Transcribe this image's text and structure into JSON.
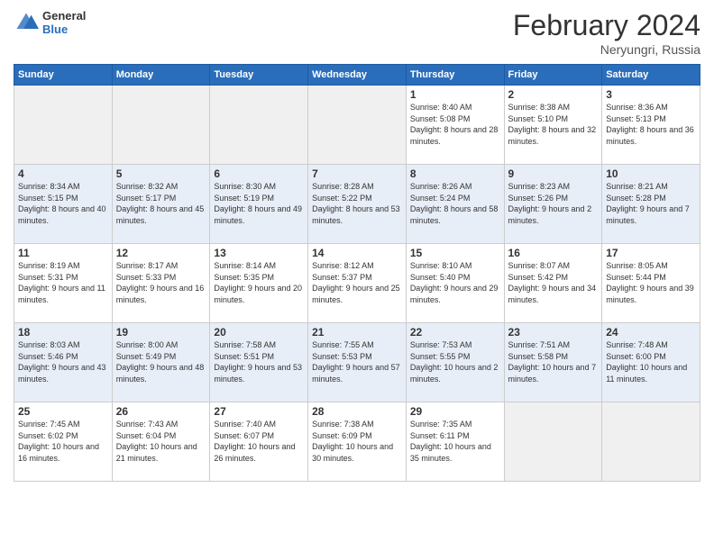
{
  "logo": {
    "general": "General",
    "blue": "Blue"
  },
  "title": {
    "month_year": "February 2024",
    "location": "Neryungri, Russia"
  },
  "headers": [
    "Sunday",
    "Monday",
    "Tuesday",
    "Wednesday",
    "Thursday",
    "Friday",
    "Saturday"
  ],
  "weeks": [
    {
      "row_class": "row-white",
      "days": [
        {
          "number": "",
          "info": "",
          "empty": true
        },
        {
          "number": "",
          "info": "",
          "empty": true
        },
        {
          "number": "",
          "info": "",
          "empty": true
        },
        {
          "number": "",
          "info": "",
          "empty": true
        },
        {
          "number": "1",
          "info": "Sunrise: 8:40 AM\nSunset: 5:08 PM\nDaylight: 8 hours\nand 28 minutes.",
          "empty": false
        },
        {
          "number": "2",
          "info": "Sunrise: 8:38 AM\nSunset: 5:10 PM\nDaylight: 8 hours\nand 32 minutes.",
          "empty": false
        },
        {
          "number": "3",
          "info": "Sunrise: 8:36 AM\nSunset: 5:13 PM\nDaylight: 8 hours\nand 36 minutes.",
          "empty": false
        }
      ]
    },
    {
      "row_class": "row-blue",
      "days": [
        {
          "number": "4",
          "info": "Sunrise: 8:34 AM\nSunset: 5:15 PM\nDaylight: 8 hours\nand 40 minutes.",
          "empty": false
        },
        {
          "number": "5",
          "info": "Sunrise: 8:32 AM\nSunset: 5:17 PM\nDaylight: 8 hours\nand 45 minutes.",
          "empty": false
        },
        {
          "number": "6",
          "info": "Sunrise: 8:30 AM\nSunset: 5:19 PM\nDaylight: 8 hours\nand 49 minutes.",
          "empty": false
        },
        {
          "number": "7",
          "info": "Sunrise: 8:28 AM\nSunset: 5:22 PM\nDaylight: 8 hours\nand 53 minutes.",
          "empty": false
        },
        {
          "number": "8",
          "info": "Sunrise: 8:26 AM\nSunset: 5:24 PM\nDaylight: 8 hours\nand 58 minutes.",
          "empty": false
        },
        {
          "number": "9",
          "info": "Sunrise: 8:23 AM\nSunset: 5:26 PM\nDaylight: 9 hours\nand 2 minutes.",
          "empty": false
        },
        {
          "number": "10",
          "info": "Sunrise: 8:21 AM\nSunset: 5:28 PM\nDaylight: 9 hours\nand 7 minutes.",
          "empty": false
        }
      ]
    },
    {
      "row_class": "row-white",
      "days": [
        {
          "number": "11",
          "info": "Sunrise: 8:19 AM\nSunset: 5:31 PM\nDaylight: 9 hours\nand 11 minutes.",
          "empty": false
        },
        {
          "number": "12",
          "info": "Sunrise: 8:17 AM\nSunset: 5:33 PM\nDaylight: 9 hours\nand 16 minutes.",
          "empty": false
        },
        {
          "number": "13",
          "info": "Sunrise: 8:14 AM\nSunset: 5:35 PM\nDaylight: 9 hours\nand 20 minutes.",
          "empty": false
        },
        {
          "number": "14",
          "info": "Sunrise: 8:12 AM\nSunset: 5:37 PM\nDaylight: 9 hours\nand 25 minutes.",
          "empty": false
        },
        {
          "number": "15",
          "info": "Sunrise: 8:10 AM\nSunset: 5:40 PM\nDaylight: 9 hours\nand 29 minutes.",
          "empty": false
        },
        {
          "number": "16",
          "info": "Sunrise: 8:07 AM\nSunset: 5:42 PM\nDaylight: 9 hours\nand 34 minutes.",
          "empty": false
        },
        {
          "number": "17",
          "info": "Sunrise: 8:05 AM\nSunset: 5:44 PM\nDaylight: 9 hours\nand 39 minutes.",
          "empty": false
        }
      ]
    },
    {
      "row_class": "row-blue",
      "days": [
        {
          "number": "18",
          "info": "Sunrise: 8:03 AM\nSunset: 5:46 PM\nDaylight: 9 hours\nand 43 minutes.",
          "empty": false
        },
        {
          "number": "19",
          "info": "Sunrise: 8:00 AM\nSunset: 5:49 PM\nDaylight: 9 hours\nand 48 minutes.",
          "empty": false
        },
        {
          "number": "20",
          "info": "Sunrise: 7:58 AM\nSunset: 5:51 PM\nDaylight: 9 hours\nand 53 minutes.",
          "empty": false
        },
        {
          "number": "21",
          "info": "Sunrise: 7:55 AM\nSunset: 5:53 PM\nDaylight: 9 hours\nand 57 minutes.",
          "empty": false
        },
        {
          "number": "22",
          "info": "Sunrise: 7:53 AM\nSunset: 5:55 PM\nDaylight: 10 hours\nand 2 minutes.",
          "empty": false
        },
        {
          "number": "23",
          "info": "Sunrise: 7:51 AM\nSunset: 5:58 PM\nDaylight: 10 hours\nand 7 minutes.",
          "empty": false
        },
        {
          "number": "24",
          "info": "Sunrise: 7:48 AM\nSunset: 6:00 PM\nDaylight: 10 hours\nand 11 minutes.",
          "empty": false
        }
      ]
    },
    {
      "row_class": "row-white",
      "days": [
        {
          "number": "25",
          "info": "Sunrise: 7:45 AM\nSunset: 6:02 PM\nDaylight: 10 hours\nand 16 minutes.",
          "empty": false
        },
        {
          "number": "26",
          "info": "Sunrise: 7:43 AM\nSunset: 6:04 PM\nDaylight: 10 hours\nand 21 minutes.",
          "empty": false
        },
        {
          "number": "27",
          "info": "Sunrise: 7:40 AM\nSunset: 6:07 PM\nDaylight: 10 hours\nand 26 minutes.",
          "empty": false
        },
        {
          "number": "28",
          "info": "Sunrise: 7:38 AM\nSunset: 6:09 PM\nDaylight: 10 hours\nand 30 minutes.",
          "empty": false
        },
        {
          "number": "29",
          "info": "Sunrise: 7:35 AM\nSunset: 6:11 PM\nDaylight: 10 hours\nand 35 minutes.",
          "empty": false
        },
        {
          "number": "",
          "info": "",
          "empty": true
        },
        {
          "number": "",
          "info": "",
          "empty": true
        }
      ]
    }
  ]
}
